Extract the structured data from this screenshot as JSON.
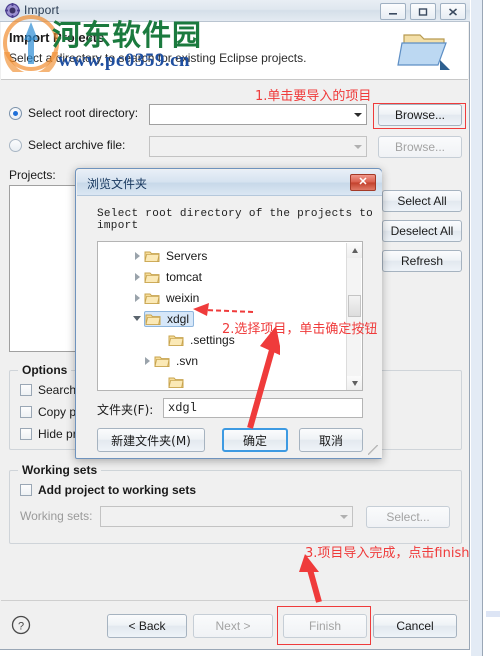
{
  "window": {
    "title": "Import",
    "icon": "eclipse-import-icon",
    "controls": [
      {
        "name": "minimize-button",
        "glyph": "—"
      },
      {
        "name": "maximize-button",
        "glyph": "▭"
      },
      {
        "name": "close-button",
        "glyph": "✕"
      }
    ]
  },
  "header": {
    "title": "Import Projects",
    "subtitle": "Select a directory to search for existing Eclipse projects.",
    "icon": "import-folder-icon"
  },
  "watermark": {
    "chinese": "河东软件园",
    "url": "www.pc0359.cn",
    "cn_color": "#1b7a3e",
    "url_color": "#1f4fa0"
  },
  "source": {
    "root_directory": {
      "label": "Select root directory:",
      "selected": true,
      "value": "",
      "browse_label": "Browse..."
    },
    "archive_file": {
      "label": "Select archive file:",
      "selected": false,
      "value": "",
      "browse_label": "Browse...",
      "enabled": false
    }
  },
  "projects": {
    "label": "Projects:",
    "items": [],
    "buttons": [
      {
        "name": "select-all-button",
        "label": "Select All"
      },
      {
        "name": "deselect-all-button",
        "label": "Deselect All"
      },
      {
        "name": "refresh-button",
        "label": "Refresh"
      }
    ]
  },
  "options": {
    "title": "Options",
    "items": [
      {
        "name": "search-nested-checkbox",
        "label": "Search fo",
        "checked": false
      },
      {
        "name": "copy-projects-checkbox",
        "label": "Copy pro",
        "checked": false
      },
      {
        "name": "hide-projects-checkbox",
        "label": "Hide proj",
        "checked": false
      }
    ]
  },
  "working_sets": {
    "title": "Working sets",
    "add_checkbox": {
      "label": "Add project to working sets",
      "checked": false
    },
    "combo_label": "Working sets:",
    "combo_value": "",
    "select_label": "Select...",
    "enabled": false
  },
  "footer": {
    "help_icon": "help-question-icon",
    "buttons": [
      {
        "name": "back-button",
        "label": "< Back",
        "enabled": true
      },
      {
        "name": "next-button",
        "label": "Next >",
        "enabled": false
      },
      {
        "name": "finish-button",
        "label": "Finish",
        "enabled": false
      },
      {
        "name": "cancel-button",
        "label": "Cancel",
        "enabled": true
      }
    ]
  },
  "browse_dialog": {
    "title": "浏览文件夹",
    "close_glyph": "✕",
    "prompt": "Select root directory of the projects to import",
    "tree": [
      {
        "name": "Servers",
        "indent": 0,
        "expandable": true,
        "expanded": false,
        "selected": false
      },
      {
        "name": "tomcat",
        "indent": 0,
        "expandable": true,
        "expanded": false,
        "selected": false
      },
      {
        "name": "weixin",
        "indent": 0,
        "expandable": true,
        "expanded": false,
        "selected": false
      },
      {
        "name": "xdgl",
        "indent": 0,
        "expandable": true,
        "expanded": true,
        "selected": true
      },
      {
        "name": ".settings",
        "indent": 1,
        "expandable": false,
        "expanded": false,
        "selected": false
      },
      {
        "name": ".svn",
        "indent": 1,
        "expandable": true,
        "expanded": false,
        "selected": false
      }
    ],
    "folder_field": {
      "label": "文件夹(F):",
      "value": "xdgl"
    },
    "buttons": [
      {
        "name": "new-folder-button",
        "label": "新建文件夹(M)",
        "primary": false
      },
      {
        "name": "ok-button",
        "label": "确定",
        "primary": true
      },
      {
        "name": "cancel-button",
        "label": "取消",
        "primary": false
      }
    ]
  },
  "annotations": [
    {
      "name": "annotation-step-1",
      "text": "1.单击要导入的项目"
    },
    {
      "name": "annotation-step-2",
      "text": "2.选择项目，单击确定按钮"
    },
    {
      "name": "annotation-step-3",
      "text": "3.项目导入完成，点击finish"
    }
  ]
}
